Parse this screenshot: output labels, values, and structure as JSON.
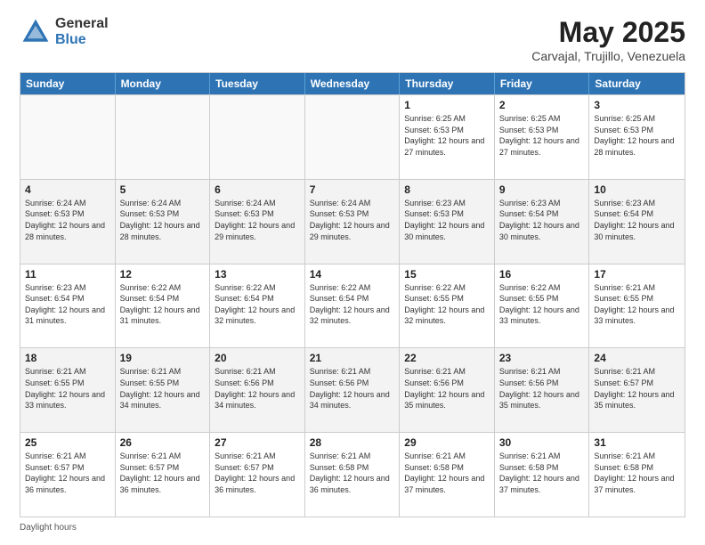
{
  "header": {
    "logo_general": "General",
    "logo_blue": "Blue",
    "month_title": "May 2025",
    "location": "Carvajal, Trujillo, Venezuela"
  },
  "days_of_week": [
    "Sunday",
    "Monday",
    "Tuesday",
    "Wednesday",
    "Thursday",
    "Friday",
    "Saturday"
  ],
  "footer": {
    "daylight_label": "Daylight hours"
  },
  "weeks": [
    {
      "cells": [
        {
          "day": "",
          "empty": true
        },
        {
          "day": "",
          "empty": true
        },
        {
          "day": "",
          "empty": true
        },
        {
          "day": "",
          "empty": true
        },
        {
          "day": "1",
          "sunrise": "6:25 AM",
          "sunset": "6:53 PM",
          "daylight": "12 hours and 27 minutes."
        },
        {
          "day": "2",
          "sunrise": "6:25 AM",
          "sunset": "6:53 PM",
          "daylight": "12 hours and 27 minutes."
        },
        {
          "day": "3",
          "sunrise": "6:25 AM",
          "sunset": "6:53 PM",
          "daylight": "12 hours and 28 minutes."
        }
      ]
    },
    {
      "cells": [
        {
          "day": "4",
          "sunrise": "6:24 AM",
          "sunset": "6:53 PM",
          "daylight": "12 hours and 28 minutes."
        },
        {
          "day": "5",
          "sunrise": "6:24 AM",
          "sunset": "6:53 PM",
          "daylight": "12 hours and 28 minutes."
        },
        {
          "day": "6",
          "sunrise": "6:24 AM",
          "sunset": "6:53 PM",
          "daylight": "12 hours and 29 minutes."
        },
        {
          "day": "7",
          "sunrise": "6:24 AM",
          "sunset": "6:53 PM",
          "daylight": "12 hours and 29 minutes."
        },
        {
          "day": "8",
          "sunrise": "6:23 AM",
          "sunset": "6:53 PM",
          "daylight": "12 hours and 30 minutes."
        },
        {
          "day": "9",
          "sunrise": "6:23 AM",
          "sunset": "6:54 PM",
          "daylight": "12 hours and 30 minutes."
        },
        {
          "day": "10",
          "sunrise": "6:23 AM",
          "sunset": "6:54 PM",
          "daylight": "12 hours and 30 minutes."
        }
      ]
    },
    {
      "cells": [
        {
          "day": "11",
          "sunrise": "6:23 AM",
          "sunset": "6:54 PM",
          "daylight": "12 hours and 31 minutes."
        },
        {
          "day": "12",
          "sunrise": "6:22 AM",
          "sunset": "6:54 PM",
          "daylight": "12 hours and 31 minutes."
        },
        {
          "day": "13",
          "sunrise": "6:22 AM",
          "sunset": "6:54 PM",
          "daylight": "12 hours and 32 minutes."
        },
        {
          "day": "14",
          "sunrise": "6:22 AM",
          "sunset": "6:54 PM",
          "daylight": "12 hours and 32 minutes."
        },
        {
          "day": "15",
          "sunrise": "6:22 AM",
          "sunset": "6:55 PM",
          "daylight": "12 hours and 32 minutes."
        },
        {
          "day": "16",
          "sunrise": "6:22 AM",
          "sunset": "6:55 PM",
          "daylight": "12 hours and 33 minutes."
        },
        {
          "day": "17",
          "sunrise": "6:21 AM",
          "sunset": "6:55 PM",
          "daylight": "12 hours and 33 minutes."
        }
      ]
    },
    {
      "cells": [
        {
          "day": "18",
          "sunrise": "6:21 AM",
          "sunset": "6:55 PM",
          "daylight": "12 hours and 33 minutes."
        },
        {
          "day": "19",
          "sunrise": "6:21 AM",
          "sunset": "6:55 PM",
          "daylight": "12 hours and 34 minutes."
        },
        {
          "day": "20",
          "sunrise": "6:21 AM",
          "sunset": "6:56 PM",
          "daylight": "12 hours and 34 minutes."
        },
        {
          "day": "21",
          "sunrise": "6:21 AM",
          "sunset": "6:56 PM",
          "daylight": "12 hours and 34 minutes."
        },
        {
          "day": "22",
          "sunrise": "6:21 AM",
          "sunset": "6:56 PM",
          "daylight": "12 hours and 35 minutes."
        },
        {
          "day": "23",
          "sunrise": "6:21 AM",
          "sunset": "6:56 PM",
          "daylight": "12 hours and 35 minutes."
        },
        {
          "day": "24",
          "sunrise": "6:21 AM",
          "sunset": "6:57 PM",
          "daylight": "12 hours and 35 minutes."
        }
      ]
    },
    {
      "cells": [
        {
          "day": "25",
          "sunrise": "6:21 AM",
          "sunset": "6:57 PM",
          "daylight": "12 hours and 36 minutes."
        },
        {
          "day": "26",
          "sunrise": "6:21 AM",
          "sunset": "6:57 PM",
          "daylight": "12 hours and 36 minutes."
        },
        {
          "day": "27",
          "sunrise": "6:21 AM",
          "sunset": "6:57 PM",
          "daylight": "12 hours and 36 minutes."
        },
        {
          "day": "28",
          "sunrise": "6:21 AM",
          "sunset": "6:58 PM",
          "daylight": "12 hours and 36 minutes."
        },
        {
          "day": "29",
          "sunrise": "6:21 AM",
          "sunset": "6:58 PM",
          "daylight": "12 hours and 37 minutes."
        },
        {
          "day": "30",
          "sunrise": "6:21 AM",
          "sunset": "6:58 PM",
          "daylight": "12 hours and 37 minutes."
        },
        {
          "day": "31",
          "sunrise": "6:21 AM",
          "sunset": "6:58 PM",
          "daylight": "12 hours and 37 minutes."
        }
      ]
    }
  ]
}
